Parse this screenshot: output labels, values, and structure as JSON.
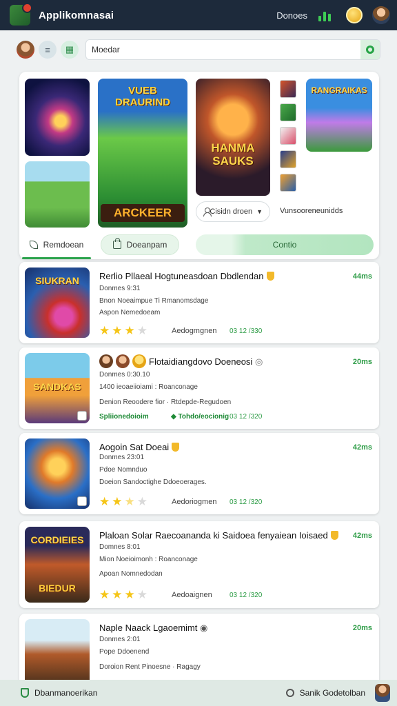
{
  "header": {
    "app_title": "Applikomnasai",
    "link_label": "Donoes",
    "icons": [
      "app-logo",
      "stats-icon",
      "coin-icon",
      "profile-icon"
    ]
  },
  "search": {
    "placeholder": "Moedar",
    "value": ""
  },
  "featured": {
    "posters": [
      {
        "title": "VUEB DRAURIND",
        "subtitle": "ARCKEER"
      },
      {
        "title": "HANMA SAUKS"
      },
      {
        "title": "RANGRAIKAS"
      }
    ],
    "sort_label": "Cisidn droen",
    "sort_hint": "Vunsooreneunidds",
    "tabs": [
      {
        "label": "Remdoean",
        "icon": "leaf-icon",
        "active": true
      },
      {
        "label": "Doeanpam",
        "icon": "bag-icon"
      },
      {
        "label": "Contio"
      }
    ]
  },
  "games": [
    {
      "title": "Rerlio Pllaeal Hogtuneasdoan Dbdlendan",
      "poster": "SIUKRAN",
      "time": "44ms",
      "line1": "Donmes 9:31",
      "line2": "Bnon Noeaimpue Ti Rmanomsdage",
      "line3": "Aspon Nemedoeam",
      "rating": 3,
      "meta_label": "Aedogmgnen",
      "meta_date": "03 12 /330"
    },
    {
      "title": "Flotaidiangdovo Doeneosi",
      "poster": "SANDKAS",
      "time": "20ms",
      "line1": "Donmes 0:30.10",
      "line2": "1400 ieoaeiioiami : Roanconage",
      "line3": "Denion Reoodere fior · Rtdepde-Regudoen",
      "line4a": "Spliionedoioim",
      "line4b": "Tohdo/eocionig",
      "meta_date": "03 12 /320"
    },
    {
      "title": "Aogoin Sat Doeai",
      "poster": "",
      "time": "42ms",
      "line1": "Donmes 23:01",
      "line2": "Pdoe Nomnduo",
      "line3": "Doeion Sandoctighe Ddoeoerages.",
      "rating": 2.5,
      "meta_label": "Aedoriogmen",
      "meta_date": "03 12 /320"
    },
    {
      "title": "Plaloan Solar Raecoananda ki Saidoea fenyaiean Ioisaed",
      "poster": "CORDIEIES",
      "poster_sub": "BIEDUR",
      "time": "42ms",
      "line1": "Domnes 8:01",
      "line2": "Mion Noeioimonh : Roanconage",
      "line3": "Apoan Nomnedodan",
      "rating": 3,
      "meta_label": "Aedoaignen",
      "meta_date": "03 12 /320"
    },
    {
      "title": "Naple Naack Lgaoemimt",
      "poster": "",
      "time": "20ms",
      "line1": "Donmes 2:01",
      "line2": "Pope Ddoenend",
      "line3": "Doroion Rent Pinoesne · Ragagy"
    }
  ],
  "bottom_bar": {
    "left_label": "Dbanmanoerikan",
    "right_label": "Sanik Godetolban"
  },
  "colors": {
    "header_bg": "#1d2a3b",
    "accent_green": "#2d9c46",
    "star": "#f5c518",
    "bottom_bar_bg": "#dfe9e4"
  }
}
